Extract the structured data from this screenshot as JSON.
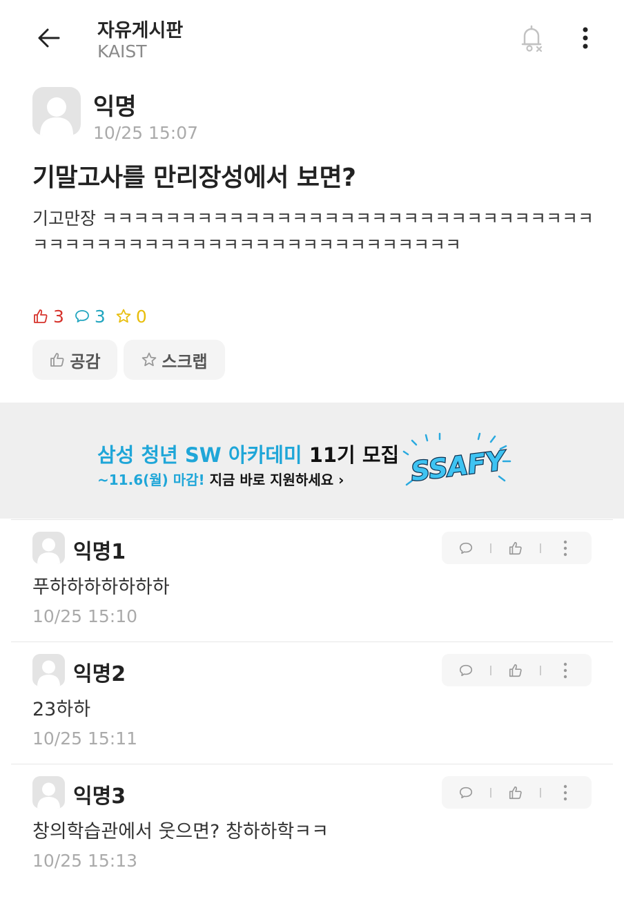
{
  "header": {
    "title": "자유게시판",
    "subtitle": "KAIST"
  },
  "post": {
    "author": "익명",
    "time": "10/25 15:07",
    "title": "기말고사를 만리장성에서 보면?",
    "body": "기고만장 ㅋㅋㅋㅋㅋㅋㅋㅋㅋㅋㅋㅋㅋㅋㅋㅋㅋㅋㅋㅋㅋㅋㅋㅋㅋㅋㅋㅋㅋㅋㅋㅋㅋㅋㅋㅋㅋㅋㅋㅋㅋㅋㅋㅋㅋㅋㅋㅋㅋㅋㅋㅋㅋㅋㅋㅋㅋㅋ",
    "stats": {
      "likes": "3",
      "comments": "3",
      "scraps": "0"
    },
    "buttons": {
      "like": "공감",
      "scrap": "스크랩"
    }
  },
  "ad": {
    "headline_blue": "삼성 청년 SW 아카데미",
    "headline_dark": " 11기 모집",
    "deadline": "~11.6(월) 마감!",
    "cta": " 지금 바로 지원하세요 ›",
    "logo_text": "SSAFY"
  },
  "comments": [
    {
      "author": "익명1",
      "text": "푸하하하하하하하",
      "time": "10/25 15:10"
    },
    {
      "author": "익명2",
      "text": "23하하",
      "time": "10/25 15:11"
    },
    {
      "author": "익명3",
      "text": "창의학습관에서 웃으면?  창하하학ㅋㅋ",
      "time": "10/25 15:13"
    }
  ],
  "colors": {
    "like": "#d6332c",
    "comment": "#21a5bf",
    "scrap": "#e8be0c",
    "ad_blue": "#1fa6d8"
  }
}
